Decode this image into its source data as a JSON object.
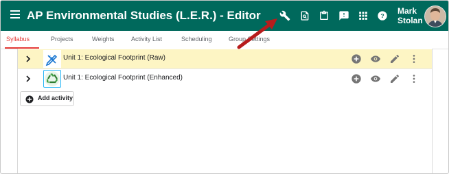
{
  "app": {
    "title": "AP Environmental Studies (L.E.R.) - Editor",
    "user": {
      "first": "Mark",
      "last": "Stolan"
    },
    "toolbar_icons": [
      "wrench-icon",
      "preview-icon",
      "clipboard-icon",
      "feedback-icon",
      "apps-grid-icon",
      "help-icon"
    ]
  },
  "tabs": [
    "Syllabus",
    "Projects",
    "Weights",
    "Activity List",
    "Scheduling",
    "Group Settings"
  ],
  "active_tab": "Syllabus",
  "activities": [
    {
      "title": "Unit 1: Ecological Footprint (Raw)",
      "highlighted": true,
      "icon": "pencil-ruler-icon"
    },
    {
      "title": "Unit 1: Ecological Footprint (Enhanced)",
      "highlighted": false,
      "icon": "recycle-icon"
    }
  ],
  "row_actions": [
    "add-circle-icon",
    "eye-icon",
    "pencil-icon",
    "more-vert-icon"
  ],
  "add_activity_label": "Add activity",
  "colors": {
    "appbar": "#00695c",
    "active_tab": "#e53935",
    "highlight_row": "#fdf5c4",
    "annotation_arrow": "#b71c1c"
  }
}
